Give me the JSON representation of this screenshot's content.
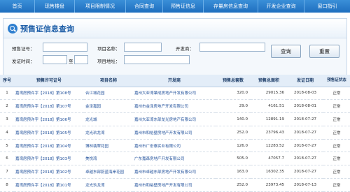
{
  "nav": [
    "首页",
    "现售楼盘",
    "项目限制情况",
    "合同查询",
    "预售证信息",
    "存量房信息查询",
    "开发企业查询",
    "窗口指引"
  ],
  "panel": {
    "title": "预售证信息查询"
  },
  "form": {
    "cert_no_label": "预售证号：",
    "project_name_label": "项目名称：",
    "developer_label": "开发商：",
    "issue_time_label": "发证时间：",
    "to_label": "至",
    "project_address_label": "项目地址：",
    "query_button": "查询",
    "reset_button": "重置"
  },
  "table": {
    "columns": [
      "序号",
      "预售许可证号",
      "项目名称",
      "开发商",
      "预售总套数",
      "预售总面积",
      "发证日期",
      "预售证状态"
    ],
    "rows": [
      [
        "1",
        "嘉湾房预许字【2018】第108号",
        "合江城花园",
        "嘉州大亚湾肇成房地产开发有限公司",
        "320.0",
        "29015.36",
        "2018-08-03",
        "正常"
      ],
      [
        "2",
        "嘉湾房预许字【2018】第107号",
        "金泽嘉园",
        "嘉州市金泽房地产开发有限公司",
        "29.0",
        "4161.51",
        "2018-08-01",
        "正常"
      ],
      [
        "3",
        "嘉湾房预许字【2018】第106号",
        "龙光城",
        "嘉州大亚湾东部龙光房地产有限公司",
        "140.0",
        "12891.19",
        "2018-07-27",
        "正常"
      ],
      [
        "4",
        "嘉湾房预许字【2018】第105号",
        "龙光玖龙湾",
        "嘉州市和裕壁房地产开发有限公司",
        "252.0",
        "23796.43",
        "2018-07-27",
        "正常"
      ],
      [
        "5",
        "嘉湾房预许字【2018】第104号",
        "博林翡翠花园",
        "嘉州市广宏泰实业有限公司",
        "126.0",
        "12283.52",
        "2018-07-27",
        "正常"
      ],
      [
        "6",
        "嘉湾房预许字【2018】第103号",
        "美悦湾",
        "广东嘉森房地产开发有限公司",
        "505.0",
        "47057.7",
        "2018-07-27",
        "正常"
      ],
      [
        "7",
        "嘉湾房预许字【2018】第102号",
        "卓越东部蔚蓝海岸花园",
        "嘉州市卓越东部房地产开发有限公司",
        "163.0",
        "16302.35",
        "2018-07-27",
        "正常"
      ],
      [
        "8",
        "嘉湾房预许字【2018】第101号",
        "龙光玖龙湾",
        "嘉州市和裕壁房地产开发有限公司",
        "252.0",
        "23973.45",
        "2018-07-13",
        "正常"
      ]
    ]
  },
  "colors": {
    "nav_bg": "#1f6fbf",
    "title": "#1f5fa8",
    "link": "#1f4f9a"
  },
  "icons": {
    "panel": "search-icon"
  }
}
